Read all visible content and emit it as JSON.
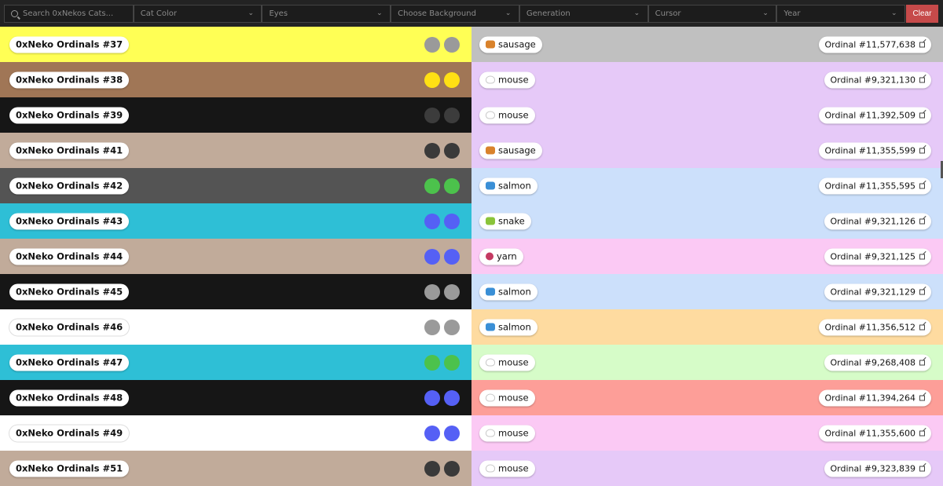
{
  "filters": {
    "search_placeholder": "Search 0xNekos Cats...",
    "cat_color": "Cat Color",
    "eyes": "Eyes",
    "background": "Choose Background",
    "generation": "Generation",
    "cursor": "Cursor",
    "year": "Year",
    "clear": "Clear"
  },
  "rows": [
    {
      "name": "0xNeko Ordinals #37",
      "color": "#ffff55",
      "eyes": "#9a9a9a",
      "item": "sausage",
      "item_icon": "sausage-icon",
      "item_color": "#d9822b",
      "bg": "#c0c0c0",
      "ordinal": "Ordinal #11,577,638"
    },
    {
      "name": "0xNeko Ordinals #38",
      "color": "#a07656",
      "eyes": "#ffe014",
      "item": "mouse",
      "item_icon": "mouse-icon",
      "item_color": "#cccccc",
      "bg": "#e6c9f8",
      "ordinal": "Ordinal #9,321,130"
    },
    {
      "name": "0xNeko Ordinals #39",
      "color": "#161616",
      "eyes": "#3c3c3c",
      "item": "mouse",
      "item_icon": "mouse-icon",
      "item_color": "#cccccc",
      "bg": "#e6c9f8",
      "ordinal": "Ordinal #11,392,509"
    },
    {
      "name": "0xNeko Ordinals #41",
      "color": "#c1ab9a",
      "eyes": "#3a3a3a",
      "item": "sausage",
      "item_icon": "sausage-icon",
      "item_color": "#d9822b",
      "bg": "#e6c9f8",
      "ordinal": "Ordinal #11,355,599"
    },
    {
      "name": "0xNeko Ordinals #42",
      "color": "#545454",
      "eyes": "#4cc24c",
      "item": "salmon",
      "item_icon": "fish-icon",
      "item_color": "#3a8fd6",
      "bg": "#cce0fb",
      "ordinal": "Ordinal #11,355,595"
    },
    {
      "name": "0xNeko Ordinals #43",
      "color": "#2ebfd6",
      "eyes": "#5560f5",
      "item": "snake",
      "item_icon": "snake-icon",
      "item_color": "#8ac43a",
      "bg": "#cce0fb",
      "ordinal": "Ordinal #9,321,126"
    },
    {
      "name": "0xNeko Ordinals #44",
      "color": "#c1ab9a",
      "eyes": "#5560f5",
      "item": "yarn",
      "item_icon": "yarn-icon",
      "item_color": "#c43a62",
      "bg": "#fbc9f4",
      "ordinal": "Ordinal #9,321,125"
    },
    {
      "name": "0xNeko Ordinals #45",
      "color": "#161616",
      "eyes": "#9a9a9a",
      "item": "salmon",
      "item_icon": "fish-icon",
      "item_color": "#3a8fd6",
      "bg": "#cce0fb",
      "ordinal": "Ordinal #9,321,129"
    },
    {
      "name": "0xNeko Ordinals #46",
      "color": "#ffffff",
      "eyes": "#9a9a9a",
      "item": "salmon",
      "item_icon": "fish-icon",
      "item_color": "#3a8fd6",
      "bg": "#fedba0",
      "ordinal": "Ordinal #11,356,512"
    },
    {
      "name": "0xNeko Ordinals #47",
      "color": "#2ebfd6",
      "eyes": "#4cc24c",
      "item": "mouse",
      "item_icon": "mouse-icon",
      "item_color": "#cccccc",
      "bg": "#d6fcc8",
      "ordinal": "Ordinal #9,268,408"
    },
    {
      "name": "0xNeko Ordinals #48",
      "color": "#161616",
      "eyes": "#5560f5",
      "item": "mouse",
      "item_icon": "mouse-icon",
      "item_color": "#cccccc",
      "bg": "#fd9e98",
      "ordinal": "Ordinal #11,394,264"
    },
    {
      "name": "0xNeko Ordinals #49",
      "color": "#ffffff",
      "eyes": "#5560f5",
      "item": "mouse",
      "item_icon": "mouse-icon",
      "item_color": "#cccccc",
      "bg": "#fbc9f4",
      "ordinal": "Ordinal #11,355,600"
    },
    {
      "name": "0xNeko Ordinals #51",
      "color": "#c1ab9a",
      "eyes": "#3a3a3a",
      "item": "mouse",
      "item_icon": "mouse-icon",
      "item_color": "#cccccc",
      "bg": "#e6c9f8",
      "ordinal": "Ordinal #9,323,839"
    }
  ]
}
